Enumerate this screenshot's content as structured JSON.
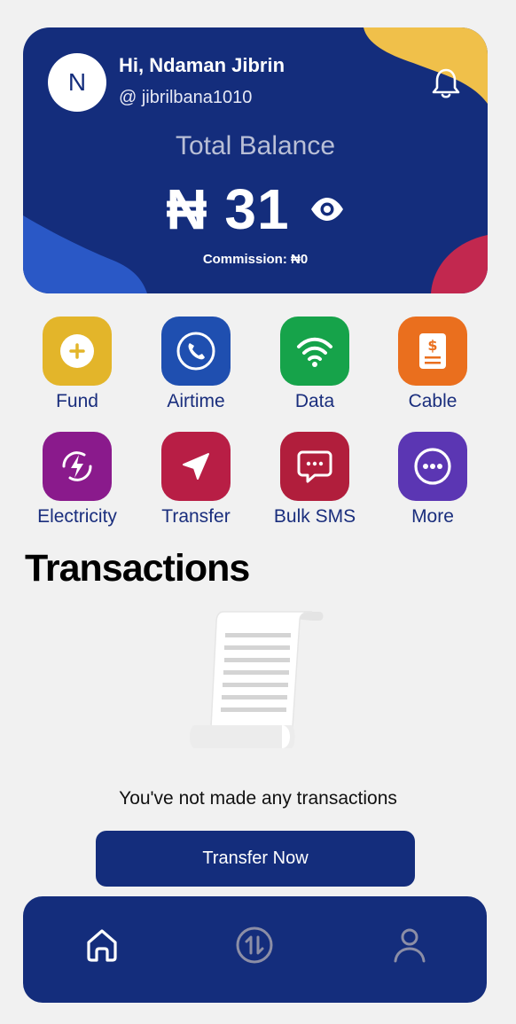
{
  "user": {
    "avatar_initial": "N",
    "greeting": "Hi, Ndaman Jibrin",
    "username": "@ jibrilbana1010"
  },
  "balance": {
    "label": "Total Balance",
    "amount": "₦ 31",
    "commission": "Commission: ₦0"
  },
  "services": [
    {
      "label": "Fund",
      "icon": "plus-icon",
      "color": "#e3b52a"
    },
    {
      "label": "Airtime",
      "icon": "phone-icon",
      "color": "#1f4fb0"
    },
    {
      "label": "Data",
      "icon": "wifi-icon",
      "color": "#16a34a"
    },
    {
      "label": "Cable",
      "icon": "bill-icon",
      "color": "#ea6f1e"
    },
    {
      "label": "Electricity",
      "icon": "lightning-icon",
      "color": "#8a1a8c"
    },
    {
      "label": "Transfer",
      "icon": "send-icon",
      "color": "#b81e45"
    },
    {
      "label": "Bulk SMS",
      "icon": "message-icon",
      "color": "#b11e3c"
    },
    {
      "label": "More",
      "icon": "more-icon",
      "color": "#5b36b3"
    }
  ],
  "transactions": {
    "title": "Transactions",
    "empty_message": "You've not made any transactions",
    "cta_label": "Transfer Now"
  },
  "bottom_nav": [
    {
      "icon": "home-icon",
      "active": true
    },
    {
      "icon": "transactions-icon",
      "active": false
    },
    {
      "icon": "profile-icon",
      "active": false
    }
  ],
  "colors": {
    "primary": "#142d7c",
    "background": "#f1f1f1",
    "accent_yellow": "#f0c04a",
    "accent_red": "#c2284f"
  }
}
